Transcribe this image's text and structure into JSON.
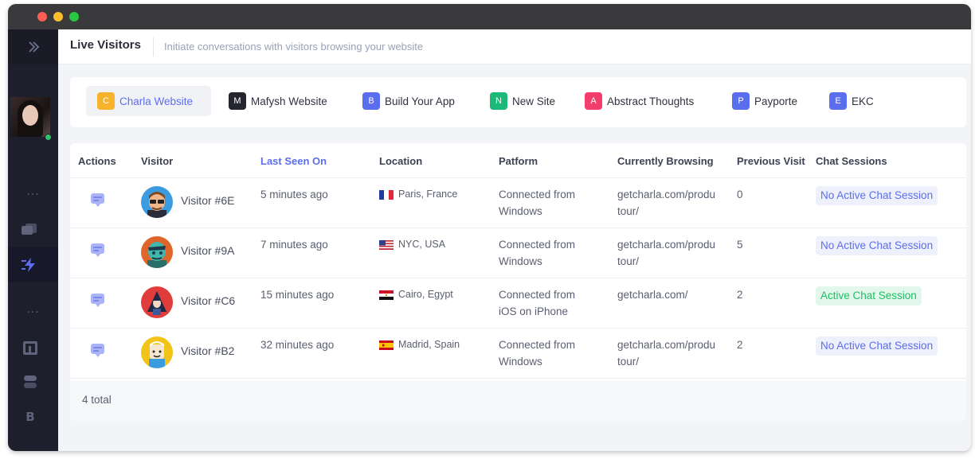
{
  "header": {
    "title": "Live Visitors",
    "subtitle": "Initiate conversations with visitors browsing your website"
  },
  "sidebar": {
    "dots_1": "...",
    "dots_2": "...",
    "brand_letter": "B"
  },
  "tabs": [
    {
      "letter": "C",
      "label": "Charla Website",
      "color": "#f8b32d",
      "active": true
    },
    {
      "letter": "M",
      "label": "Mafysh Website",
      "color": "#24252f",
      "active": false
    },
    {
      "letter": "B",
      "label": "Build Your App",
      "color": "#5b6ef0",
      "active": false
    },
    {
      "letter": "N",
      "label": "New Site",
      "color": "#1cb877",
      "active": false
    },
    {
      "letter": "A",
      "label": "Abstract Thoughts",
      "color": "#f23d6d",
      "active": false
    },
    {
      "letter": "P",
      "label": "Payporte",
      "color": "#5b6ef0",
      "active": false
    },
    {
      "letter": "E",
      "label": "EKC",
      "color": "#5b6ef0",
      "active": false
    }
  ],
  "table": {
    "columns": [
      "Actions",
      "Visitor",
      "Last Seen On",
      "Location",
      "Patform",
      "Currently Browsing",
      "Previous Visit",
      "Chat Sessions"
    ],
    "rows": [
      {
        "visitor": "Visitor #6E",
        "last_seen": "5 minutes ago",
        "location": "Paris, France",
        "flag": "france",
        "platform_1": "Connected from",
        "platform_2": "Windows",
        "browsing_1": "getcharla.com/produ",
        "browsing_2": "tour/",
        "previous": "0",
        "session": "No Active Chat Session",
        "session_active": false,
        "avatar_color": "#3b9be0"
      },
      {
        "visitor": "Visitor #9A",
        "last_seen": "7 minutes ago",
        "location": "NYC, USA",
        "flag": "usa",
        "platform_1": "Connected from",
        "platform_2": "Windows",
        "browsing_1": "getcharla.com/produ",
        "browsing_2": "tour/",
        "previous": "5",
        "session": "No Active Chat Session",
        "session_active": false,
        "avatar_color": "#e0652a"
      },
      {
        "visitor": "Visitor #C6",
        "last_seen": "15 minutes ago",
        "location": "Cairo, Egypt",
        "flag": "egypt",
        "platform_1": "Connected from",
        "platform_2": "iOS on iPhone",
        "browsing_1": "getcharla.com/",
        "browsing_2": "",
        "previous": "2",
        "session": "Active Chat Session",
        "session_active": true,
        "avatar_color": "#e03c3c"
      },
      {
        "visitor": "Visitor #B2",
        "last_seen": "32 minutes ago",
        "location": "Madrid, Spain",
        "flag": "spain",
        "platform_1": "Connected from",
        "platform_2": "Windows",
        "browsing_1": "getcharla.com/produ",
        "browsing_2": "tour/",
        "previous": "2",
        "session": "No Active Chat Session",
        "session_active": false,
        "avatar_color": "#f2c318"
      }
    ],
    "total": "4 total"
  }
}
